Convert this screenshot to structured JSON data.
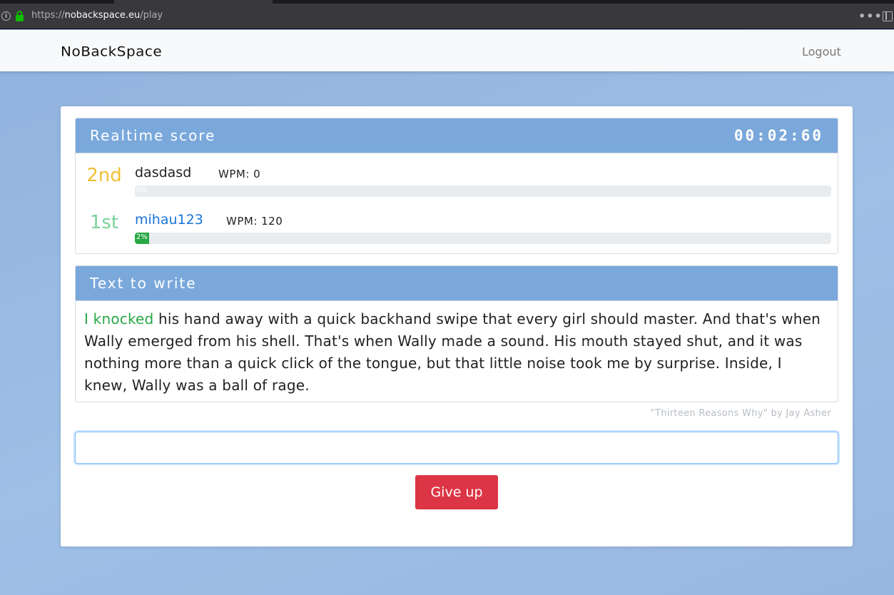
{
  "browser": {
    "url_scheme": "https://",
    "url_host": "nobackspace.eu",
    "url_path": "/play"
  },
  "navbar": {
    "brand": "NoBackSpace",
    "logout_label": "Logout"
  },
  "score": {
    "title": "Realtime score",
    "timer": "00:02:60",
    "players": [
      {
        "rank": "2nd",
        "rank_color": "#f0c036",
        "name": "dasdasd",
        "name_color": "#222222",
        "wpm": "WPM: 0",
        "progress_label": "0%",
        "progress": 0,
        "bar_color": "#28a745"
      },
      {
        "rank": "1st",
        "rank_color": "#7bd19a",
        "name": "mihau123",
        "name_color": "#1a73d9",
        "wpm": "WPM: 120",
        "progress_label": "2%",
        "progress": 2,
        "bar_color": "#28a745"
      }
    ]
  },
  "text_to_write": {
    "title": "Text to write",
    "typed": "I knocked",
    "remaining": " his hand away with a quick backhand swipe that every girl should master. And that's when Wally emerged from his shell. That's when Wally made a sound. His mouth stayed shut, and it was nothing more than a quick click of the tongue, but that little noise took me by surprise. Inside, I knew, Wally was a ball of rage.",
    "source": "\"Thirteen Reasons Why\" by Jay Asher"
  },
  "input": {
    "value": "",
    "placeholder": ""
  },
  "giveup_label": "Give up",
  "colors": {
    "panel_header": "#7aa8db",
    "typed_text": "#28a745",
    "danger": "#dc3545"
  }
}
